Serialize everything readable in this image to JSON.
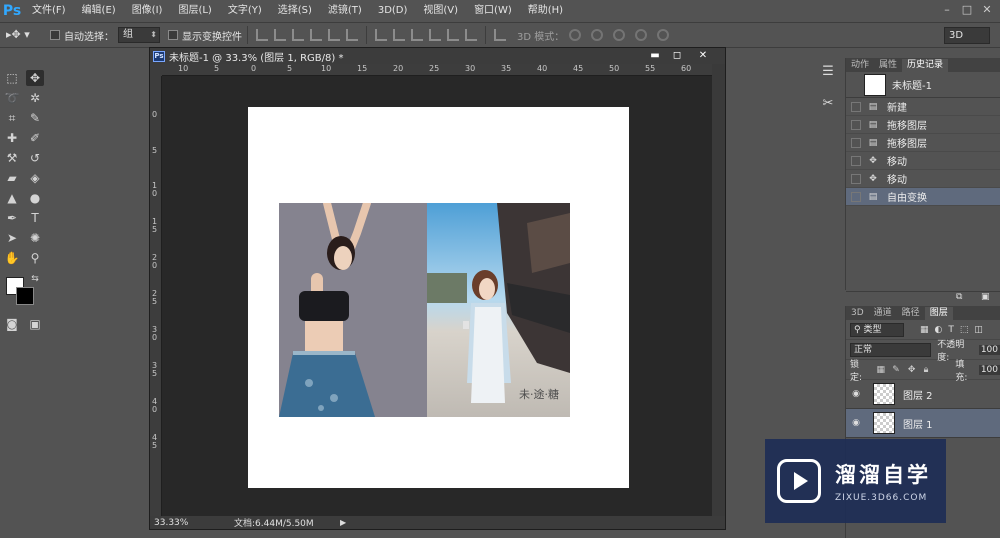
{
  "app": {
    "logo": "Ps"
  },
  "menu": [
    "文件(F)",
    "编辑(E)",
    "图像(I)",
    "图层(L)",
    "文字(Y)",
    "选择(S)",
    "滤镜(T)",
    "3D(D)",
    "视图(V)",
    "窗口(W)",
    "帮助(H)"
  ],
  "options": {
    "auto_select_label": "自动选择：",
    "auto_select_value": "组",
    "show_transform_label": "显示变换控件",
    "mode3d_label": "3D 模式：",
    "workspace": "3D"
  },
  "document": {
    "title": "未标题-1 @ 33.3% (图层 1, RGB/8) *",
    "zoom": "33.33%",
    "doc_size": "文档:6.44M/5.50M",
    "ruler_top": [
      "10",
      "5",
      "0",
      "5",
      "10",
      "15",
      "20",
      "25",
      "30",
      "35",
      "40",
      "45",
      "50",
      "55",
      "60"
    ],
    "ruler_left": [
      "0",
      "5",
      "1 0",
      "1 5",
      "2 0",
      "2 5",
      "3 0",
      "3 5",
      "4 0",
      "4 5"
    ],
    "photo_signature": "未·途·糖"
  },
  "history_panel": {
    "tabs": [
      "动作",
      "属性",
      "历史记录"
    ],
    "snapshot": "未标题-1",
    "items": [
      {
        "label": "新建",
        "icon": "document-icon"
      },
      {
        "label": "拖移图层",
        "icon": "document-icon"
      },
      {
        "label": "拖移图层",
        "icon": "document-icon"
      },
      {
        "label": "移动",
        "icon": "move-icon"
      },
      {
        "label": "移动",
        "icon": "move-icon"
      },
      {
        "label": "自由变换",
        "icon": "document-icon",
        "selected": true
      }
    ]
  },
  "layers_panel": {
    "tabs": [
      "3D",
      "通道",
      "路径",
      "图层"
    ],
    "filter": "类型",
    "blend_mode": "正常",
    "opacity_label": "不透明度:",
    "opacity_value": "100",
    "lock_label": "锁定:",
    "fill_label": "填充:",
    "fill_value": "100",
    "layers": [
      {
        "name": "图层 2",
        "selected": false
      },
      {
        "name": "图层 1",
        "selected": true
      }
    ]
  },
  "watermark": {
    "title": "溜溜自学",
    "subtitle": "ZIXUE.3D66.COM"
  },
  "colors": {
    "accent_selected": "#5f6a7d",
    "ps_blue": "#31a8ff"
  }
}
